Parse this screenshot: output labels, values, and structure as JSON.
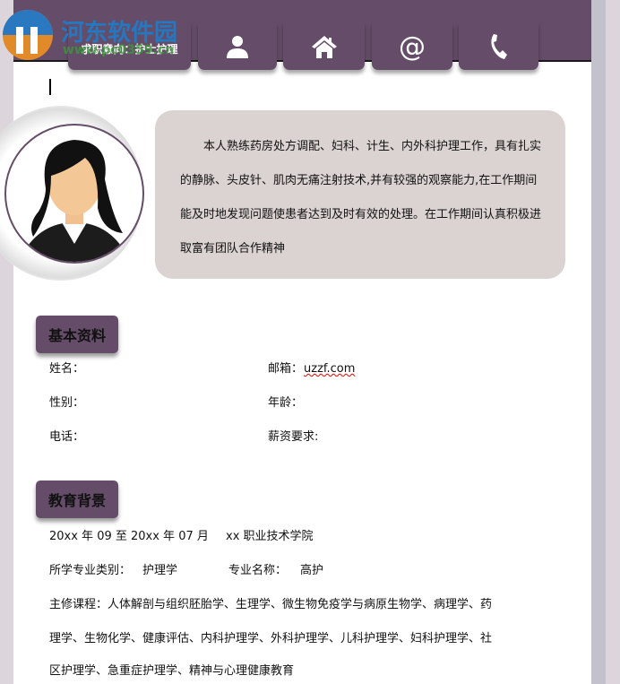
{
  "watermark": {
    "title": "河东软件园",
    "url": "www.pc0359.cn"
  },
  "header": {
    "tabs": [
      {
        "label": "求职意向：护士护理"
      },
      {
        "icon": "person-icon"
      },
      {
        "icon": "home-icon"
      },
      {
        "icon": "at-icon"
      },
      {
        "icon": "phone-icon"
      }
    ]
  },
  "summary": "本人熟练药房处方调配、妇科、计生、内外科护理工作，具有扎实的静脉、头皮针、肌肉无痛注射技术,并有较强的观察能力,在工作期间能及时地发现问题使患者达到及时有效的处理。在工作期间认真积极进取富有团队合作精神",
  "basic": {
    "title": "基本资料",
    "name_label": "姓名：",
    "email_label": "邮箱：",
    "email_value": "uzzf.com",
    "gender_label": "性别：",
    "age_label": "年龄：",
    "phone_label": "电话：",
    "salary_label": "薪资要求:"
  },
  "education": {
    "title": "教育背景",
    "period": "20xx 年 09 至 20xx 年 07 月",
    "school": "xx 职业技术学院",
    "category_label": "所学专业类别：",
    "category_value": "护理学",
    "major_label": "专业名称：",
    "major_value": "高护",
    "courses_line1": "主修课程：人体解剖与组织胚胎学、生理学、微生物免疫学与病原生物学、病理学、药",
    "courses_line2": "理学、生物化学、健康评估、内科护理学、外科护理学、儿科护理学、妇科护理学、社",
    "courses_line3": "区护理学、急重症护理学、精神与心理健康教育"
  }
}
